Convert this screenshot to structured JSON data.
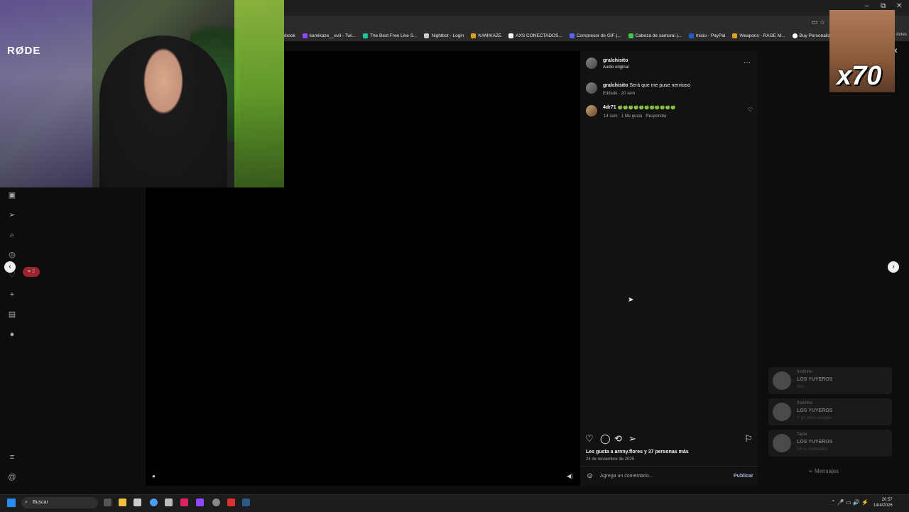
{
  "window": {
    "minimize": "–",
    "restore": "⧉",
    "close": "✕"
  },
  "bookmarks": [
    {
      "label": "ebook",
      "color": ""
    },
    {
      "label": "kamikaze__evil - Twi...",
      "color": "#9146ff"
    },
    {
      "label": "The Best Free Live S...",
      "color": "#1fc7a0"
    },
    {
      "label": "Nightbot - Login",
      "color": "#cccccc"
    },
    {
      "label": "KAMIKAZE",
      "color": "#e0a020"
    },
    {
      "label": "AXS CONECTADOS...",
      "color": "#ffffff"
    },
    {
      "label": "Compresor de GIF |...",
      "color": "#5865f2"
    },
    {
      "label": "Cabeza de samurai |...",
      "color": "#3cc850"
    },
    {
      "label": "Inicio - PayPal",
      "color": "#1e5bc6"
    },
    {
      "label": "Weapons - RAGE M...",
      "color": "#e0a020"
    },
    {
      "label": "Buy Personalized 11...",
      "color": "#ffffff"
    }
  ],
  "bookmarks_end": "dores",
  "webcam": {
    "mic_brand": "RØDE"
  },
  "meme": {
    "text": "x70"
  },
  "leftnav": {
    "notification_count": "3",
    "icons": [
      "reels-icon",
      "messages-icon",
      "search-icon",
      "explore-icon",
      "heart-icon",
      "create-icon",
      "dashboard-icon",
      "profile-icon",
      "menu-icon",
      "threads-icon"
    ]
  },
  "post": {
    "author": "gralchisito",
    "audio": "Audio original",
    "more": "···",
    "caption_user": "gralchisito",
    "caption_text": "Será que me puse nervioso",
    "caption_meta": "Editado · 20 sem",
    "comment": {
      "user": "4dr71",
      "text": "🍏🍏🍏🍏🍏🍏🍏🍏🍏🍏🍏",
      "age": "14 sem",
      "likes": "1 Me gusta",
      "reply": "Responder"
    },
    "liked_by": "Les gusta a arnny.flores y 37 personas más",
    "date": "24 de noviembre de 2025",
    "comment_placeholder": "Agrega un comentario...",
    "publish": "Publicar"
  },
  "chats": [
    {
      "name": "fredinho",
      "title": "LOS YUYEROS",
      "sub": "Aoo"
    },
    {
      "name": "fredinho",
      "title": "LOS YUYEROS",
      "sub": "Y yo no lo escogía"
    },
    {
      "name": "Tapia",
      "title": "LOS YUYEROS",
      "sub": "Oh si motivadita"
    }
  ],
  "messages_label": "Mensajes",
  "taskbar": {
    "search_placeholder": "Buscar",
    "time": "20:57",
    "date": "14/4/2026"
  }
}
